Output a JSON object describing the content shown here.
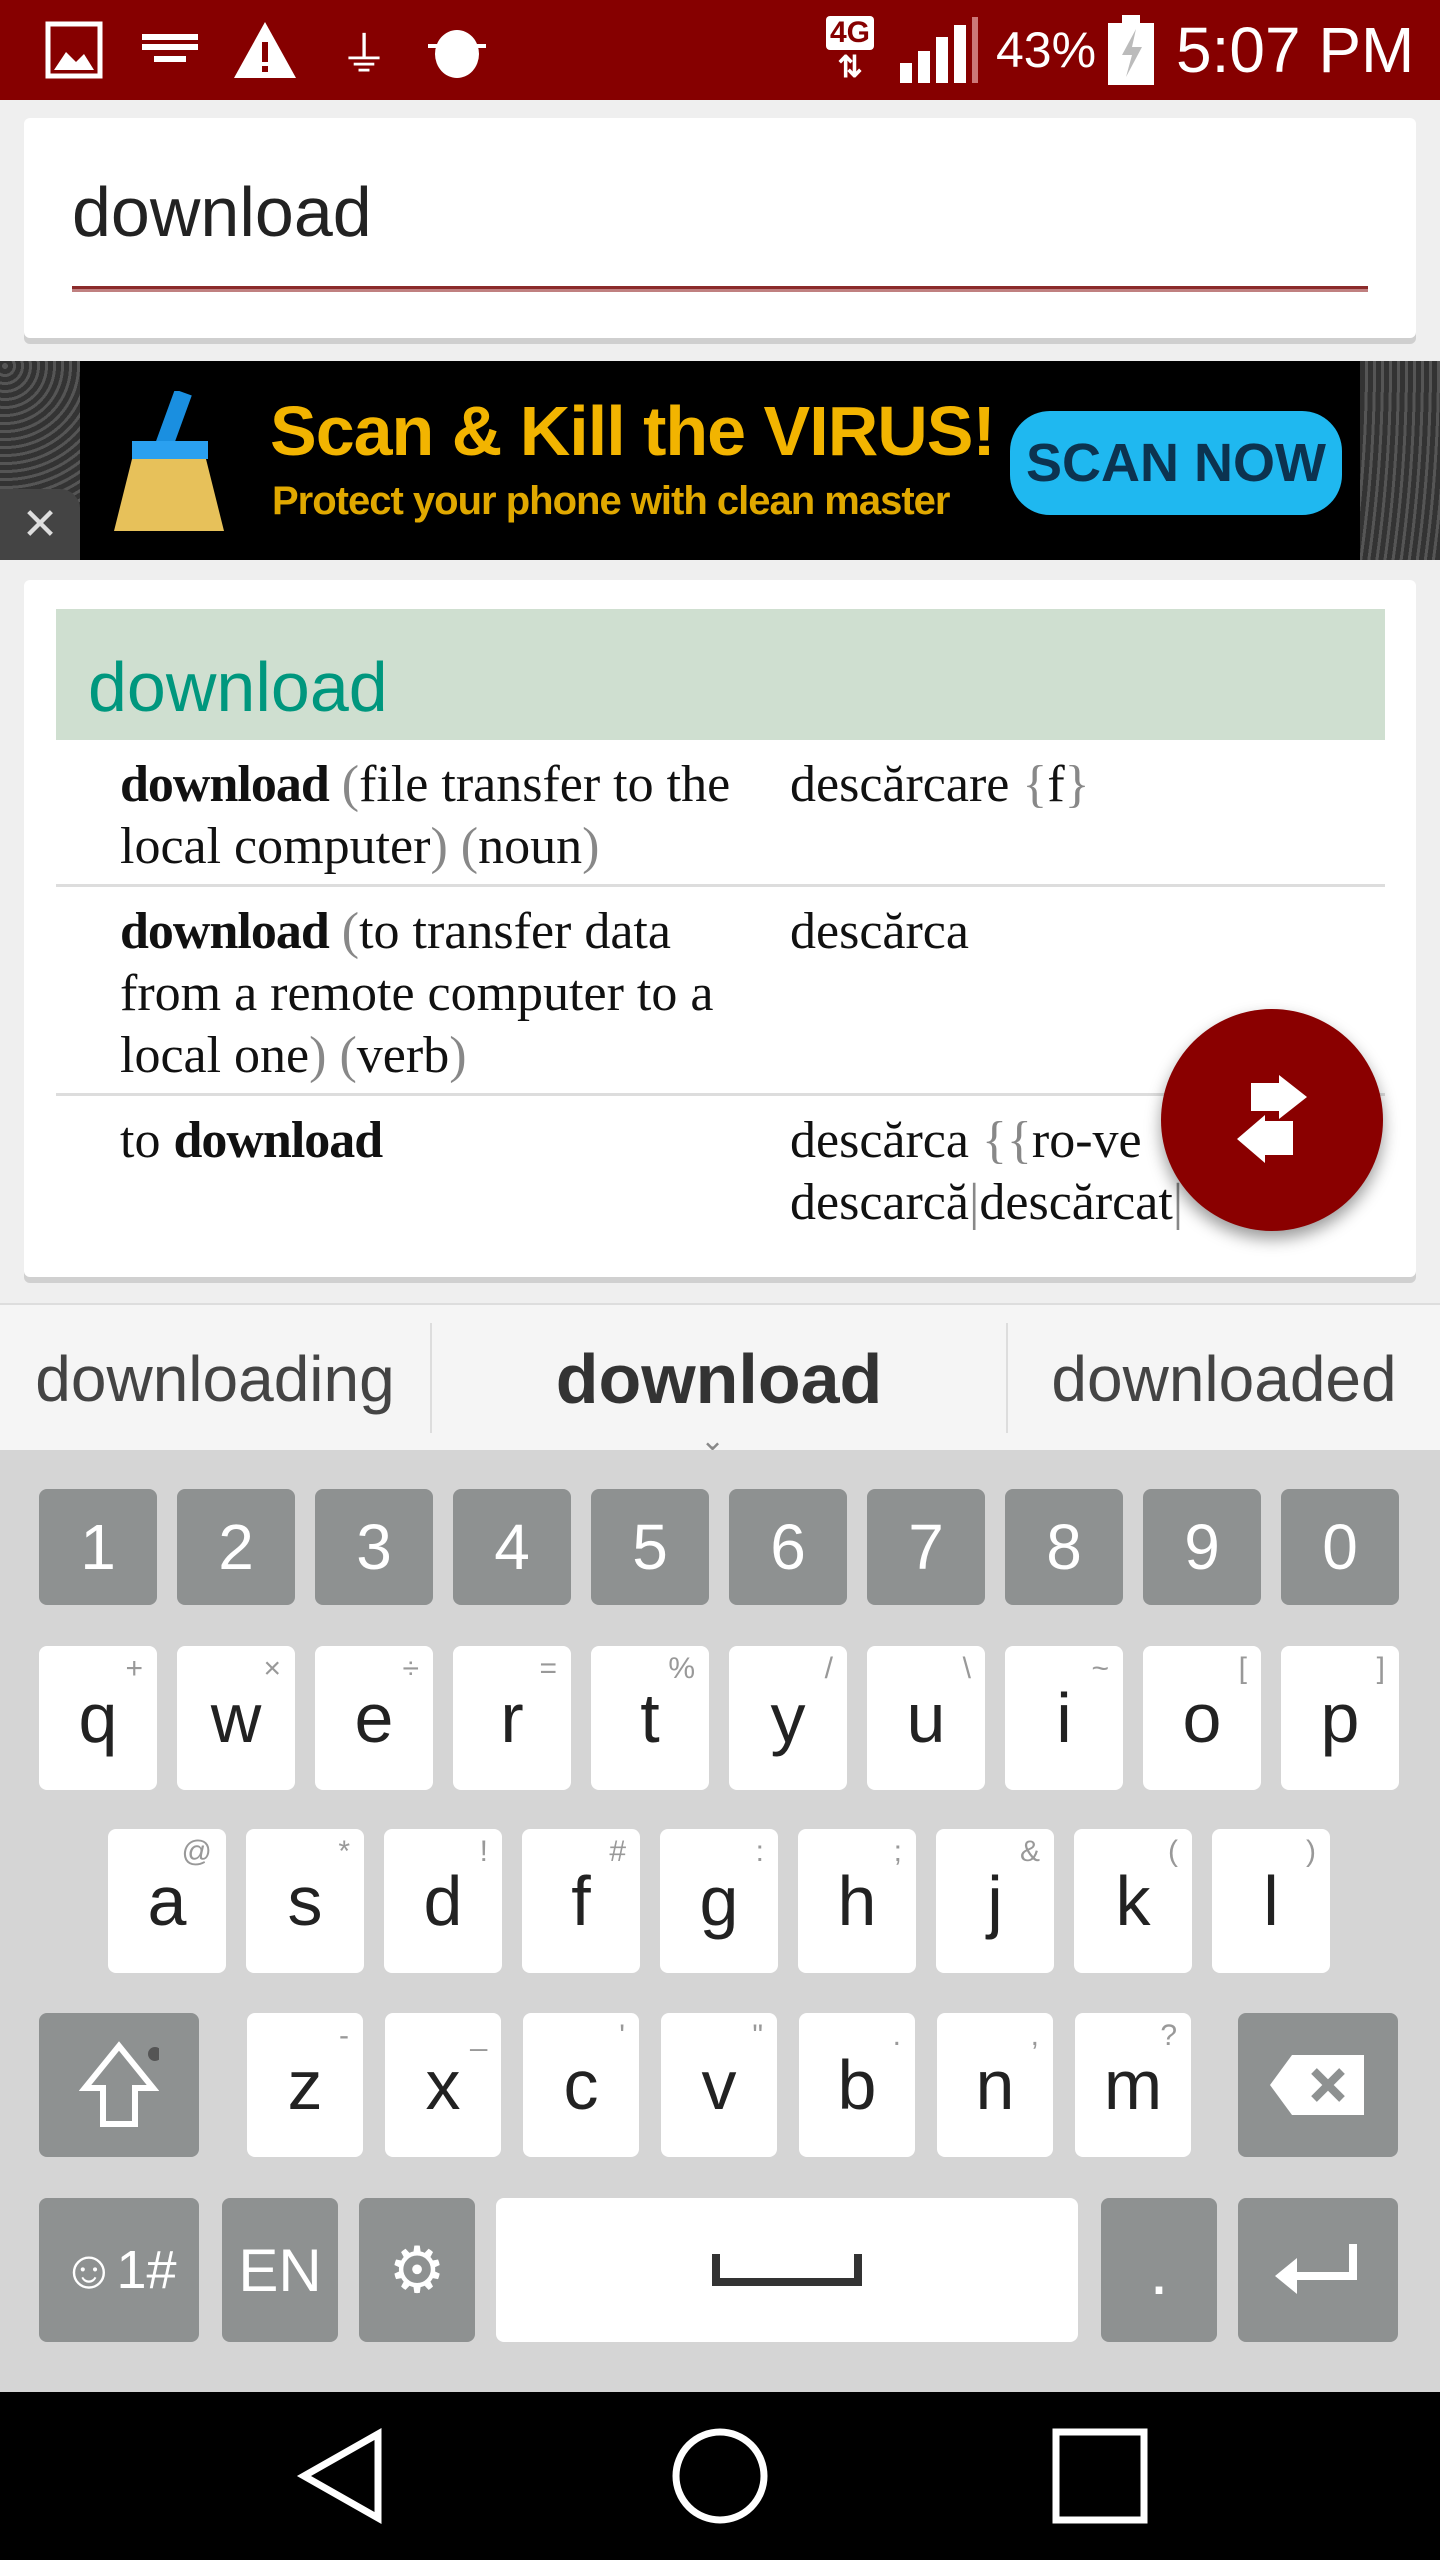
{
  "status_bar": {
    "icons": [
      "image-icon",
      "keyboard-icon",
      "warning-icon",
      "usb-icon",
      "android-debug-icon",
      "4g-data-icon",
      "signal-icon",
      "battery-charging-icon"
    ],
    "network": "4G",
    "battery": "43%",
    "time": "5:07 PM"
  },
  "search": {
    "value": "download"
  },
  "ad": {
    "title": "Scan & Kill the VIRUS!",
    "subtitle": "Protect your phone with clean master",
    "button": "SCAN NOW",
    "close": "✕"
  },
  "result": {
    "headword": "download",
    "rows": [
      {
        "left": [
          {
            "t": "download",
            "s": "b"
          },
          {
            "t": " (",
            "s": "p"
          },
          {
            "t": "file transfer to the local computer",
            "s": ""
          },
          {
            "t": ")",
            "s": "p"
          },
          {
            "t": " (",
            "s": "p"
          },
          {
            "t": "noun",
            "s": ""
          },
          {
            "t": ")",
            "s": "p"
          }
        ],
        "right": [
          {
            "t": "descărcare ",
            "s": ""
          },
          {
            "t": "{",
            "s": "p"
          },
          {
            "t": "f",
            "s": ""
          },
          {
            "t": "}",
            "s": "p"
          }
        ]
      },
      {
        "left": [
          {
            "t": "download",
            "s": "b"
          },
          {
            "t": " (",
            "s": "p"
          },
          {
            "t": "to transfer data from a remote computer to a local one",
            "s": ""
          },
          {
            "t": ")",
            "s": "p"
          },
          {
            "t": " (",
            "s": "p"
          },
          {
            "t": "verb",
            "s": ""
          },
          {
            "t": ")",
            "s": "p"
          }
        ],
        "right": [
          {
            "t": "descărca",
            "s": ""
          }
        ]
      },
      {
        "left": [
          {
            "t": "to ",
            "s": ""
          },
          {
            "t": "download",
            "s": "b"
          }
        ],
        "right": [
          {
            "t": "descărca ",
            "s": ""
          },
          {
            "t": "{{",
            "s": "p"
          },
          {
            "t": "ro-ve",
            "s": ""
          },
          {
            "t": "\n",
            "s": ""
          },
          {
            "t": "descarcă",
            "s": ""
          },
          {
            "t": "|",
            "s": "p"
          },
          {
            "t": "descărcat",
            "s": ""
          },
          {
            "t": "|",
            "s": "p"
          }
        ]
      }
    ]
  },
  "fab": {
    "icon": "swap-languages-icon",
    "color": "#8a0000"
  },
  "suggestions": [
    "downloading",
    "download",
    "downloaded"
  ],
  "keyboard": {
    "numbers": [
      "1",
      "2",
      "3",
      "4",
      "5",
      "6",
      "7",
      "8",
      "9",
      "0"
    ],
    "row1": [
      [
        "q",
        "+"
      ],
      [
        "w",
        "×"
      ],
      [
        "e",
        "÷"
      ],
      [
        "r",
        "="
      ],
      [
        "t",
        "%"
      ],
      [
        "y",
        "/"
      ],
      [
        "u",
        "\\"
      ],
      [
        "i",
        "~"
      ],
      [
        "o",
        "["
      ],
      [
        "p",
        "]"
      ]
    ],
    "row2": [
      [
        "a",
        "@"
      ],
      [
        "s",
        "*"
      ],
      [
        "d",
        "!"
      ],
      [
        "f",
        "#"
      ],
      [
        "g",
        ":"
      ],
      [
        "h",
        ";"
      ],
      [
        "j",
        "&"
      ],
      [
        "k",
        "("
      ],
      [
        "l",
        ")"
      ]
    ],
    "row3": [
      [
        "z",
        "-"
      ],
      [
        "x",
        "_"
      ],
      [
        "c",
        "'"
      ],
      [
        "v",
        "\""
      ],
      [
        "b",
        "."
      ],
      [
        "n",
        ","
      ],
      [
        "m",
        "?"
      ]
    ],
    "emoji_key": "☺1#",
    "lang_key": "EN",
    "period_key": "."
  },
  "nav": {
    "icons": [
      "back-icon",
      "home-icon",
      "recents-icon"
    ]
  }
}
